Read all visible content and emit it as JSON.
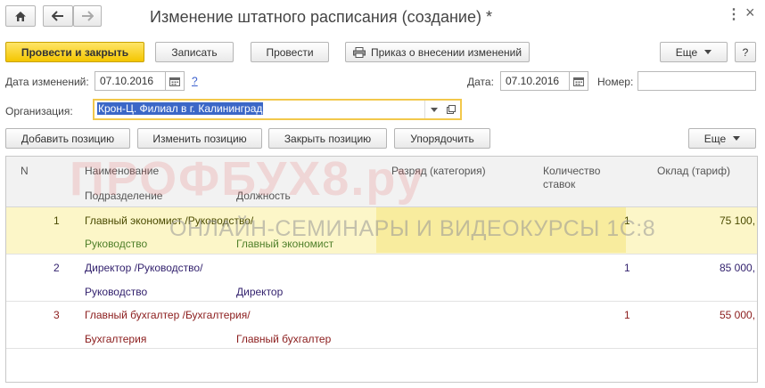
{
  "window": {
    "title": "Изменение штатного расписания (создание) *",
    "more_label": "⋮",
    "close_label": "×"
  },
  "toolbar": {
    "post_close_label": "Провести и закрыть",
    "save_label": "Записать",
    "post_label": "Провести",
    "order_label": "Приказ о внесении изменений",
    "more_label": "Еще",
    "help_label": "?"
  },
  "form": {
    "change_date_label": "Дата изменений:",
    "change_date_value": "07.10.2016",
    "help_link": "?",
    "date_label": "Дата:",
    "date_value": "07.10.2016",
    "number_label": "Номер:",
    "number_value": "",
    "org_label": "Организация:",
    "org_value": "Крон-Ц. Филиал в г. Калининград"
  },
  "table_toolbar": {
    "add_label": "Добавить позицию",
    "edit_label": "Изменить позицию",
    "close_label": "Закрыть позицию",
    "sort_label": "Упорядочить",
    "more_label": "Еще"
  },
  "table": {
    "headers": {
      "n": "N",
      "name": "Наименование",
      "department": "Подразделение",
      "position": "Должность",
      "grade": "Разряд (категория)",
      "rates_line1": "Количество",
      "rates_line2": "ставок",
      "salary": "Оклад (тариф)"
    },
    "rows": [
      {
        "n": "1",
        "name": "Главный экономист /Руководство/",
        "department": "Руководство",
        "position": "Главный экономист",
        "rates": "1",
        "salary": "75 100,"
      },
      {
        "n": "2",
        "name": "Директор /Руководство/",
        "department": "Руководство",
        "position": "Директор",
        "rates": "1",
        "salary": "85 000,"
      },
      {
        "n": "3",
        "name": "Главный бухгалтер /Бухгалтерия/",
        "department": "Бухгалтерия",
        "position": "Главный бухгалтер",
        "rates": "1",
        "salary": "55 000,"
      }
    ]
  },
  "watermark": {
    "logo": "ПРОФБУХ8.ру",
    "subtitle": "ОНЛАЙН-СЕМИНАРЫ И ВИДЕОКУРСЫ 1С:8"
  },
  "colors": {
    "selected_row_bg": "#fcf6c8",
    "row1_text": "#4a4a00",
    "row1_sub": "#4f7f2a",
    "row2_text": "#33226e",
    "row3_text": "#8b1c1c",
    "accent_yellow": "#f4c600"
  }
}
